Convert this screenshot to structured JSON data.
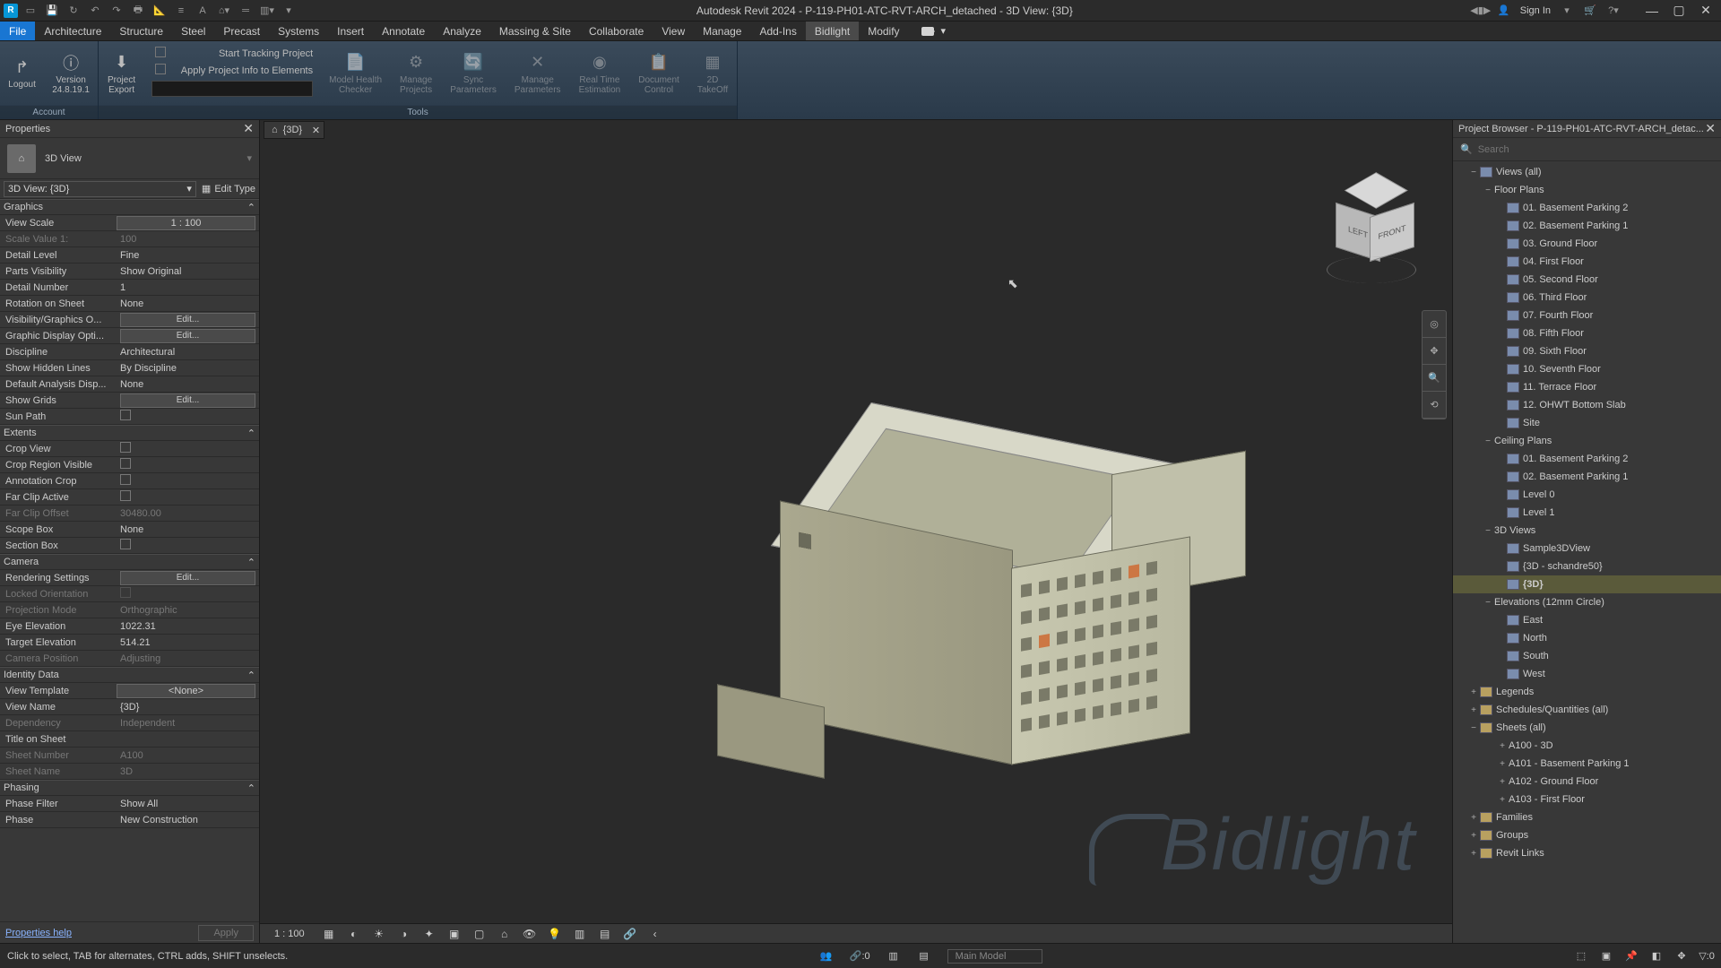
{
  "app": {
    "title": "Autodesk Revit 2024 - P-119-PH01-ATC-RVT-ARCH_detached - 3D View: {3D}",
    "logo": "R",
    "signin": "Sign In"
  },
  "menu": {
    "file": "File",
    "items": [
      "Architecture",
      "Structure",
      "Steel",
      "Precast",
      "Systems",
      "Insert",
      "Annotate",
      "Analyze",
      "Massing & Site",
      "Collaborate",
      "View",
      "Manage",
      "Add-Ins",
      "Bidlight",
      "Modify"
    ],
    "active": "Bidlight"
  },
  "ribbon": {
    "account": "Account",
    "tools": "Tools",
    "logout": "Logout",
    "version": "Version\n24.8.19.1",
    "export": "Project\nExport",
    "start_tracking": "Start Tracking Project",
    "apply_info": "Apply Project Info to Elements",
    "mhc": "Model Health\nChecker",
    "mp": "Manage\nProjects",
    "sp": "Sync\nParameters",
    "mpar": "Manage\nParameters",
    "rte": "Real Time\nEstimation",
    "dc": "Document\nControl",
    "to": "2D\nTakeOff"
  },
  "props": {
    "title": "Properties",
    "type": "3D View",
    "instance": "3D View: {3D}",
    "edit_type": "Edit Type",
    "groups": {
      "graphics": "Graphics",
      "extents": "Extents",
      "camera": "Camera",
      "identity": "Identity Data",
      "phasing": "Phasing"
    },
    "rows": {
      "view_scale": {
        "k": "View Scale",
        "v": "1 : 100"
      },
      "scale_value": {
        "k": "Scale Value    1:",
        "v": "100"
      },
      "detail": {
        "k": "Detail Level",
        "v": "Fine"
      },
      "parts": {
        "k": "Parts Visibility",
        "v": "Show Original"
      },
      "detail_num": {
        "k": "Detail Number",
        "v": "1"
      },
      "rotation": {
        "k": "Rotation on Sheet",
        "v": "None"
      },
      "vg": {
        "k": "Visibility/Graphics O...",
        "v": "Edit..."
      },
      "gdo": {
        "k": "Graphic Display Opti...",
        "v": "Edit..."
      },
      "disc": {
        "k": "Discipline",
        "v": "Architectural"
      },
      "hidden": {
        "k": "Show Hidden Lines",
        "v": "By Discipline"
      },
      "dad": {
        "k": "Default Analysis Disp...",
        "v": "None"
      },
      "grids": {
        "k": "Show Grids",
        "v": "Edit..."
      },
      "sun": {
        "k": "Sun Path",
        "v": ""
      },
      "crop": {
        "k": "Crop View",
        "v": ""
      },
      "crop_vis": {
        "k": "Crop Region Visible",
        "v": ""
      },
      "anno_crop": {
        "k": "Annotation Crop",
        "v": ""
      },
      "far_clip": {
        "k": "Far Clip Active",
        "v": ""
      },
      "far_off": {
        "k": "Far Clip Offset",
        "v": "30480.00"
      },
      "scope": {
        "k": "Scope Box",
        "v": "None"
      },
      "section": {
        "k": "Section Box",
        "v": ""
      },
      "render": {
        "k": "Rendering Settings",
        "v": "Edit..."
      },
      "locked": {
        "k": "Locked Orientation",
        "v": ""
      },
      "proj": {
        "k": "Projection Mode",
        "v": "Orthographic"
      },
      "eye": {
        "k": "Eye Elevation",
        "v": "1022.31"
      },
      "target": {
        "k": "Target Elevation",
        "v": "514.21"
      },
      "campos": {
        "k": "Camera Position",
        "v": "Adjusting"
      },
      "tmpl": {
        "k": "View Template",
        "v": "<None>"
      },
      "vname": {
        "k": "View Name",
        "v": "{3D}"
      },
      "dep": {
        "k": "Dependency",
        "v": "Independent"
      },
      "tos": {
        "k": "Title on Sheet",
        "v": ""
      },
      "snum": {
        "k": "Sheet Number",
        "v": "A100"
      },
      "sname": {
        "k": "Sheet Name",
        "v": "3D"
      },
      "pfilter": {
        "k": "Phase Filter",
        "v": "Show All"
      },
      "phase": {
        "k": "Phase",
        "v": "New Construction"
      }
    },
    "help": "Properties help",
    "apply": "Apply"
  },
  "view": {
    "tab": "{3D}",
    "cube": {
      "left": "LEFT",
      "front": "FRONT"
    },
    "scale": "1 : 100"
  },
  "browser": {
    "title": "Project Browser - P-119-PH01-ATC-RVT-ARCH_detac...",
    "search_ph": "Search",
    "views_all": "Views (all)",
    "floor_plans": "Floor Plans",
    "fp": [
      "01. Basement Parking 2",
      "02. Basement Parking 1",
      "03. Ground Floor",
      "04. First Floor",
      "05. Second Floor",
      "06. Third Floor",
      "07. Fourth Floor",
      "08. Fifth Floor",
      "09. Sixth Floor",
      "10. Seventh Floor",
      "11. Terrace Floor",
      "12. OHWT Bottom Slab",
      "Site"
    ],
    "ceiling": "Ceiling Plans",
    "cp": [
      "01. Basement Parking 2",
      "02. Basement Parking 1",
      "Level 0",
      "Level 1"
    ],
    "3dviews": "3D Views",
    "v3d": [
      "Sample3DView",
      "{3D - schandre50}",
      "{3D}"
    ],
    "elev": "Elevations (12mm Circle)",
    "el": [
      "East",
      "North",
      "South",
      "West"
    ],
    "legends": "Legends",
    "sched": "Schedules/Quantities (all)",
    "sheets": "Sheets (all)",
    "sh": [
      "A100 - 3D",
      "A101 - Basement Parking 1",
      "A102 - Ground Floor",
      "A103 - First Floor"
    ],
    "families": "Families",
    "groups": "Groups",
    "links": "Revit Links"
  },
  "status": {
    "msg": "Click to select, TAB for alternates, CTRL adds, SHIFT unselects.",
    "workset": "Main Model",
    "sel0": ":0"
  },
  "watermark": "Bidlight"
}
